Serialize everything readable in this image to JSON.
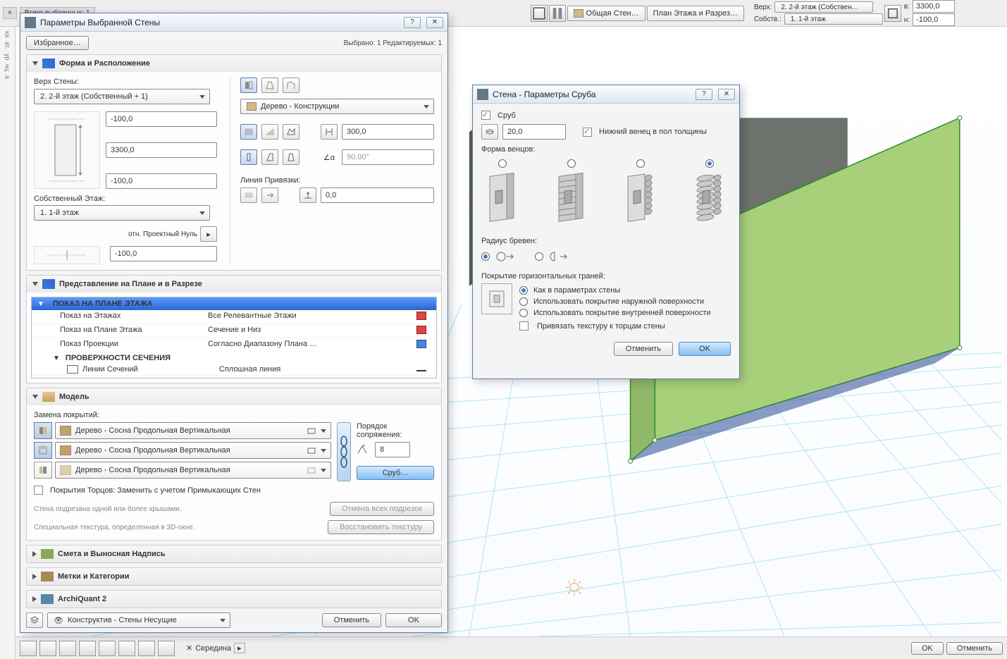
{
  "top": {
    "tab_close": "×",
    "sel_total": "Всего выбранных: 1",
    "btn_wall": "Общая Стен…",
    "btn_plan": "План Этажа и Разрез…",
    "lbl_top": "Верх:",
    "val_top": "2. 2-й этаж (Собствен…",
    "lbl_own": "Собств.:",
    "val_own": "1. 1-й этаж",
    "lbl_w": "в:",
    "val_w": "3300,0",
    "lbl_h": "н:",
    "val_h": "-100,0"
  },
  "d1": {
    "title": "Параметры Выбранной Стены",
    "favorites": "Избранное…",
    "selected_info": "Выбрано: 1 Редактируемых: 1",
    "sec_form": "Форма и Расположение",
    "top_wall_lbl": "Верх Стены:",
    "top_wall_val": "2. 2-й этаж (Собственный + 1)",
    "offset_top": "-100,0",
    "height": "3300,0",
    "offset_bot": "-100,0",
    "own_floor_lbl": "Собственный Этаж:",
    "own_floor_val": "1. 1-й этаж",
    "rel_zero": "отн. Проектный Нуль",
    "proj_zero_val": "-100,0",
    "material_val": "Дерево - Конструкции",
    "thickness": "300,0",
    "angle": "90,00°",
    "refline_lbl": "Линия Привязки:",
    "refline_val": "0,0",
    "sec_plan": "Представление на Плане и в Разрезе",
    "tree_hdr": "ПОКАЗ НА ПЛАНЕ ЭТАЖА",
    "tree": [
      {
        "k": "Показ на Этажах",
        "v": "Все Релевантные Этажи"
      },
      {
        "k": "Показ на Плане Этажа",
        "v": "Сечение и Низ"
      },
      {
        "k": "Показ Проекции",
        "v": "Согласно Диапазону Плана …"
      }
    ],
    "tree_sub": "ПРОВЕРХНОСТИ СЕЧЕНИЯ",
    "tree_sub_row": {
      "k": "Линии Сечений",
      "v": "Сплошная линия"
    },
    "sec_model": "Модель",
    "override_lbl": "Замена покрытий:",
    "surf1": "Дерево - Сосна Продольная Вертикальная",
    "surf2": "Дерево - Сосна Продольная Вертикальная",
    "surf3": "Дерево - Сосна Продольная Вертикальная",
    "junction_lbl": "Порядок сопряжения:",
    "junction_val": "8",
    "log_btn": "Сруб…",
    "end_surf_chk": "Покрытия Торцов: Заменить с учетом Примыкающих Стен",
    "note1": "Стена подрезана одной или более крышами.",
    "note2": "Специальная текстура, определенная в 3D-окне.",
    "undo_trim": "Отмена всех подрезок",
    "restore_tex": "Восстановить текстуру",
    "sec_list": "Смета и Выносная Надпись",
    "sec_tags": "Метки и Категории",
    "sec_aq": "ArchiQuant 2",
    "layer_val": "Конструктив - Стены Несущие",
    "cancel": "Отменить",
    "ok": "OK"
  },
  "d2": {
    "title": "Стена - Параметры Сруба",
    "chk_log": "Сруб",
    "diam": "20,0",
    "chk_half": "Нижний венец в пол толщины",
    "shape_lbl": "Форма венцов:",
    "radius_lbl": "Радиус бревен:",
    "cover_lbl": "Покрытие горизонтальных граней:",
    "cov1": "Как в параметрах стены",
    "cov2": "Использовать покрытие наружной поверхности",
    "cov3": "Использовать покрытие внутренней поверхности",
    "chk_tex": "Привязать текстуру к торцам стены",
    "cancel": "Отменить",
    "ok": "OK"
  },
  "bottom": {
    "mid": "Середина",
    "ok": "OK",
    "cancel": "Отменить"
  }
}
